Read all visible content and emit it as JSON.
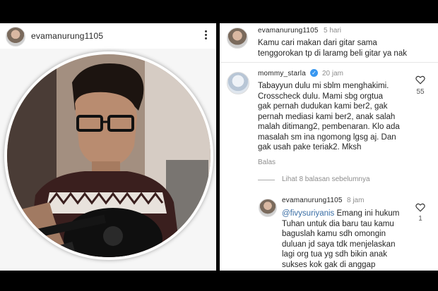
{
  "post": {
    "username": "evamanurung1105",
    "more_icon": "more-vertical-icon"
  },
  "comments": [
    {
      "username": "evamanurung1105",
      "time": "5 hari",
      "text": "Kamu cari makan dari gitar sama\ntenggorokan tp di laramg beli gitar ya nak"
    },
    {
      "username": "mommy_starla",
      "verified": true,
      "time": "20 jam",
      "text": "Tabayyun dulu mi sblm menghakimi.\nCrosscheck dulu. Mami sbg orgtua\ngak pernah dudukan kami ber2, gak\npernah mediasi kami ber2, anak salah\nmalah ditimang2, pembenaran. Klo ada\nmasalah sm ina ngomong lgsg aj. Dan\ngak usah pake teriak2. Mksh",
      "likes": "55",
      "reply_label": "Balas"
    }
  ],
  "view_replies": "Lihat 8 balasan sebelumnya",
  "reply": {
    "username": "evamanurung1105",
    "time": "8 jam",
    "mention": "@fivysuriyanis",
    "text_first": " Emang ini hukum",
    "text_rest": "Tuhan untuk dia baru tau kamu\nbaguslah kamu sdh omongin\nduluan jd saya tdk menjelaskan\nlagi org tua yg sdh bikin anak\nsukses kok gak di anggap",
    "likes": "1"
  },
  "colors": {
    "link": "#3a6ea5",
    "verified": "#3897f0",
    "muted": "#8e8e8e"
  }
}
